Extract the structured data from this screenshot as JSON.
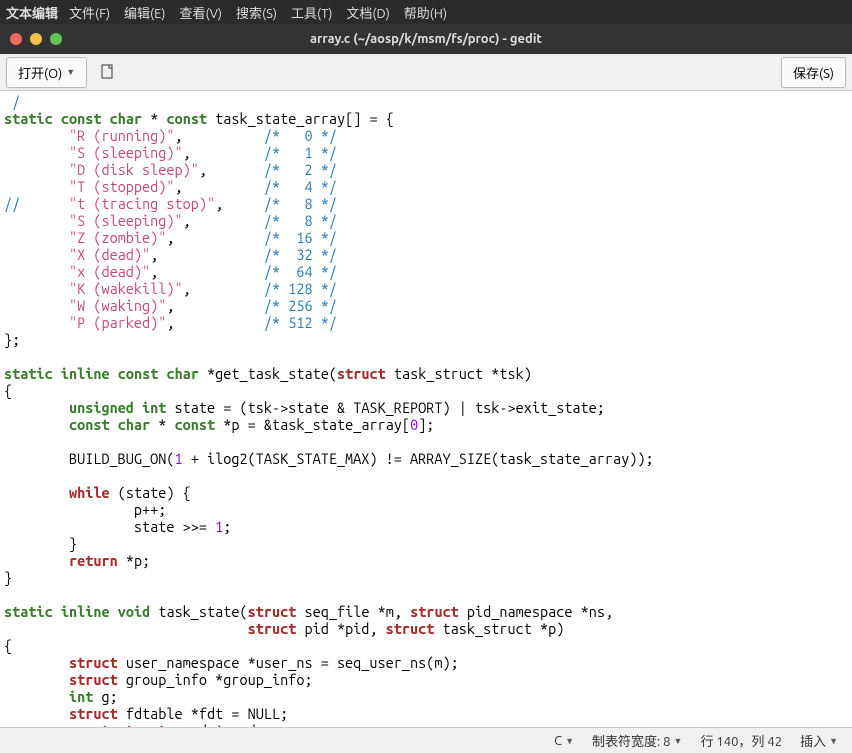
{
  "menubar": {
    "app": "文本编辑",
    "items": [
      "文件(F)",
      "编辑(E)",
      "查看(V)",
      "搜索(S)",
      "工具(T)",
      "文档(D)",
      "帮助(H)"
    ]
  },
  "window": {
    "title": "array.c (~/aosp/k/msm/fs/proc) - gedit",
    "dots": [
      "#ed6a5e",
      "#f4bf4e",
      "#61c554"
    ]
  },
  "toolbar": {
    "open_label": "打开(O)",
    "save_label": "保存(S)"
  },
  "code": {
    "l0_cmt": " /",
    "l1_a": "static",
    "l1_b": "const",
    "l1_c": "char",
    "l1_d": " * ",
    "l1_e": "const",
    "l1_f": " task_state_array[] = {",
    "s0": "\"R (running)\"",
    "c0": "/*   0 */",
    "s1": "\"S (sleeping)\"",
    "c1": "/*   1 */",
    "s2": "\"D (disk sleep)\"",
    "c2": "/*   2 */",
    "s3": "\"T (stopped)\"",
    "c3": "/*   4 */",
    "l_cc": "//",
    "s4": "\"t (tracing stop)\"",
    "c4": "/*   8 */",
    "s5": "\"S (sleeping)\"",
    "c5": "/*   8 */",
    "s6": "\"Z (zombie)\"",
    "c6": "/*  16 */",
    "s7": "\"X (dead)\"",
    "c7": "/*  32 */",
    "s8": "\"x (dead)\"",
    "c8": "/*  64 */",
    "s9": "\"K (wakekill)\"",
    "c9": "/* 128 */",
    "s10": "\"W (waking)\"",
    "c10": "/* 256 */",
    "s11": "\"P (parked)\"",
    "c11": "/* 512 */",
    "close": "};",
    "fn1_a": "static",
    "fn1_b": "inline",
    "fn1_c": "const",
    "fn1_d": "char",
    "fn1_e": " *get_task_state(",
    "fn1_f": "struct",
    "fn1_g": " task_struct *tsk)",
    "ob": "{",
    "b1_a": "unsigned",
    "b1_b": "int",
    "b1_c": " state = (tsk->state & TASK_REPORT) | tsk->exit_state;",
    "b2_a": "const",
    "b2_b": "char",
    "b2_c": " * ",
    "b2_d": "const",
    "b2_e": " *p = &task_state_array[",
    "b2_n": "0",
    "b2_f": "];",
    "b3_a": "        BUILD_BUG_ON(",
    "b3_n": "1",
    "b3_b": " + ilog2(TASK_STATE_MAX) != ARRAY_SIZE(task_state_array));",
    "w_a": "while",
    "w_b": " (state) {",
    "w_c": "                p++;",
    "w_d": "                state >>= ",
    "w_n": "1",
    "w_e": ";",
    "w_f": "        }",
    "r_a": "return",
    "r_b": " *p;",
    "cb": "}",
    "fn2_a": "static",
    "fn2_b": "inline",
    "fn2_c": "void",
    "fn2_d": " task_state(",
    "fn2_e": "struct",
    "fn2_f": " seq_file *m, ",
    "fn2_g": "struct",
    "fn2_h": " pid_namespace *ns,",
    "fn2_i": "                              ",
    "fn2_j": "struct",
    "fn2_k": " pid *pid, ",
    "fn2_l": "struct",
    "fn2_m": " task_struct *p)",
    "v1_a": "struct",
    "v1_b": " user_namespace *user_ns = seq_user_ns(m);",
    "v2_a": "struct",
    "v2_b": " group_info *group_info;",
    "v3_a": "int",
    "v3_b": " g;",
    "v4_a": "struct",
    "v4_b": " fdtable *fdt = NULL;",
    "v5_a": "const",
    "v5_b": "struct",
    "v5_c": " cred *cred;"
  },
  "status": {
    "lang": "C",
    "tabwidth": "制表符宽度: 8",
    "pos": "行 140，列 42",
    "ins": "插入"
  }
}
